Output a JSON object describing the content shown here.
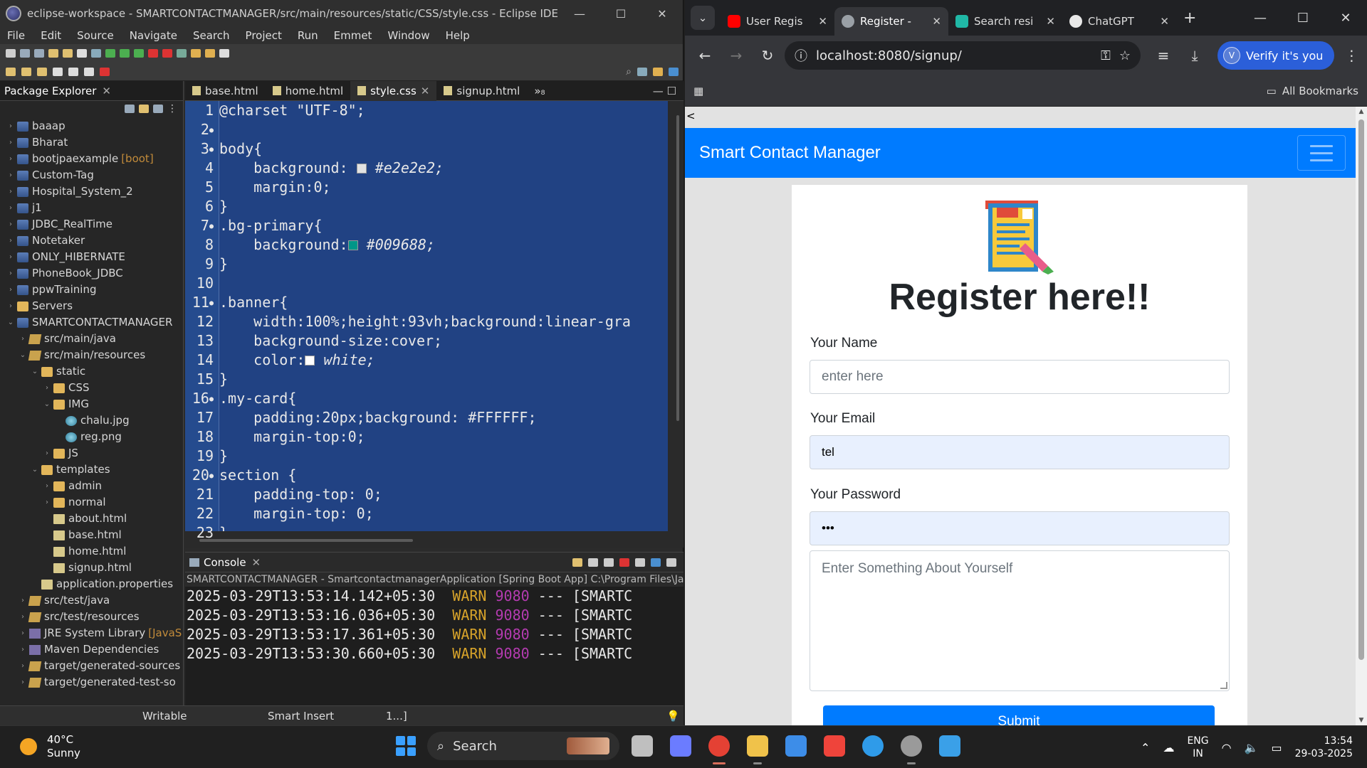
{
  "eclipse": {
    "title": "eclipse-workspace - SMARTCONTACTMANAGER/src/main/resources/static/CSS/style.css - Eclipse IDE",
    "menu": [
      "File",
      "Edit",
      "Source",
      "Navigate",
      "Search",
      "Project",
      "Run",
      "Emmet",
      "Window",
      "Help"
    ],
    "package_explorer": {
      "label": "Package Explorer",
      "items": [
        {
          "label": "baaap",
          "indent": 0,
          "icon": "project-icon"
        },
        {
          "label": "Bharat",
          "indent": 0,
          "icon": "project-icon"
        },
        {
          "label": "bootjpaexample",
          "decoration": "[boot]",
          "indent": 0,
          "icon": "project-icon"
        },
        {
          "label": "Custom-Tag",
          "indent": 0,
          "icon": "project-icon"
        },
        {
          "label": "Hospital_System_2",
          "indent": 0,
          "icon": "project-icon"
        },
        {
          "label": "j1",
          "indent": 0,
          "icon": "project-icon"
        },
        {
          "label": "JDBC_RealTime",
          "indent": 0,
          "icon": "project-icon"
        },
        {
          "label": "Notetaker",
          "indent": 0,
          "icon": "project-icon"
        },
        {
          "label": "ONLY_HIBERNATE",
          "indent": 0,
          "icon": "project-icon"
        },
        {
          "label": "PhoneBook_JDBC",
          "indent": 0,
          "icon": "project-icon"
        },
        {
          "label": "ppwTraining",
          "indent": 0,
          "icon": "project-icon"
        },
        {
          "label": "Servers",
          "indent": 0,
          "icon": "folder-icon"
        },
        {
          "label": "SMARTCONTACTMANAGER",
          "indent": 0,
          "icon": "project-icon"
        },
        {
          "label": "src/main/java",
          "indent": 1,
          "icon": "package-folder-icon"
        },
        {
          "label": "src/main/resources",
          "indent": 1,
          "icon": "package-folder-icon"
        },
        {
          "label": "static",
          "indent": 2,
          "icon": "folder-icon"
        },
        {
          "label": "CSS",
          "indent": 3,
          "icon": "folder-icon"
        },
        {
          "label": "IMG",
          "indent": 3,
          "icon": "folder-icon"
        },
        {
          "label": "chalu.jpg",
          "indent": 4,
          "icon": "image-file-icon"
        },
        {
          "label": "reg.png",
          "indent": 4,
          "icon": "image-file-icon"
        },
        {
          "label": "JS",
          "indent": 3,
          "icon": "folder-icon"
        },
        {
          "label": "templates",
          "indent": 2,
          "icon": "folder-icon"
        },
        {
          "label": "admin",
          "indent": 3,
          "icon": "folder-icon"
        },
        {
          "label": "normal",
          "indent": 3,
          "icon": "folder-icon"
        },
        {
          "label": "about.html",
          "indent": 3,
          "icon": "html-file-icon"
        },
        {
          "label": "base.html",
          "indent": 3,
          "icon": "html-file-icon"
        },
        {
          "label": "home.html",
          "indent": 3,
          "icon": "html-file-icon"
        },
        {
          "label": "signup.html",
          "indent": 3,
          "icon": "html-file-icon"
        },
        {
          "label": "application.properties",
          "indent": 2,
          "icon": "properties-file-icon"
        },
        {
          "label": "src/test/java",
          "indent": 1,
          "icon": "package-folder-icon"
        },
        {
          "label": "src/test/resources",
          "indent": 1,
          "icon": "package-folder-icon"
        },
        {
          "label": "JRE System Library",
          "decoration": "[JavaS",
          "indent": 1,
          "icon": "library-icon"
        },
        {
          "label": "Maven Dependencies",
          "indent": 1,
          "icon": "library-icon"
        },
        {
          "label": "target/generated-sources",
          "indent": 1,
          "icon": "package-folder-icon"
        },
        {
          "label": "target/generated-test-so",
          "indent": 1,
          "icon": "package-folder-icon"
        }
      ]
    },
    "editor_tabs": [
      {
        "label": "base.html",
        "active": false
      },
      {
        "label": "home.html",
        "active": false
      },
      {
        "label": "style.css",
        "active": true
      },
      {
        "label": "signup.html",
        "active": false
      }
    ],
    "editor_overflow": "»₈",
    "code_lines": [
      {
        "n": "1",
        "dot": "",
        "text": "@charset \"UTF-8\";"
      },
      {
        "n": "2",
        "dot": "●",
        "text": ""
      },
      {
        "n": "3",
        "dot": "●",
        "text": "body{"
      },
      {
        "n": "4",
        "dot": "",
        "text": "    background: ",
        "swatch": "#e2e2e2",
        "after": " #e2e2e2;"
      },
      {
        "n": "5",
        "dot": "",
        "text": "    margin:0;"
      },
      {
        "n": "6",
        "dot": "",
        "text": "}"
      },
      {
        "n": "7",
        "dot": "●",
        "text": ".bg-primary{"
      },
      {
        "n": "8",
        "dot": "",
        "text": "    background:",
        "swatch": "#009688",
        "after": " #009688;"
      },
      {
        "n": "9",
        "dot": "",
        "text": "}"
      },
      {
        "n": "10",
        "dot": "",
        "text": ""
      },
      {
        "n": "11",
        "dot": "●",
        "text": ".banner{"
      },
      {
        "n": "12",
        "dot": "",
        "text": "    width:100%;height:93vh;background:linear-gra"
      },
      {
        "n": "13",
        "dot": "",
        "text": "    background-size:cover;"
      },
      {
        "n": "14",
        "dot": "",
        "text": "    color:",
        "swatch": "#ffffff",
        "after": " white;"
      },
      {
        "n": "15",
        "dot": "",
        "text": "}"
      },
      {
        "n": "16",
        "dot": "●",
        "text": ".my-card{"
      },
      {
        "n": "17",
        "dot": "",
        "text": "    padding:20px;background: #FFFFFF;"
      },
      {
        "n": "18",
        "dot": "",
        "text": "    margin-top:0;"
      },
      {
        "n": "19",
        "dot": "",
        "text": "}"
      },
      {
        "n": "20",
        "dot": "●",
        "text": "section {"
      },
      {
        "n": "21",
        "dot": "",
        "text": "    padding-top: 0;"
      },
      {
        "n": "22",
        "dot": "",
        "text": "    margin-top: 0;"
      },
      {
        "n": "23",
        "dot": "",
        "text": "}"
      }
    ],
    "console": {
      "label": "Console",
      "subtitle": "SMARTCONTACTMANAGER - SmartcontactmanagerApplication [Spring Boot App] C:\\Program Files\\Java\\",
      "logs": [
        {
          "ts": "2025-03-29T13:53:14.142+05:30",
          "level": "WARN",
          "pid": "9080",
          "rest": "--- [SMARTC"
        },
        {
          "ts": "2025-03-29T13:53:16.036+05:30",
          "level": "WARN",
          "pid": "9080",
          "rest": "--- [SMARTC"
        },
        {
          "ts": "2025-03-29T13:53:17.361+05:30",
          "level": "WARN",
          "pid": "9080",
          "rest": "--- [SMARTC"
        },
        {
          "ts": "2025-03-29T13:53:30.660+05:30",
          "level": "WARN",
          "pid": "9080",
          "rest": "--- [SMARTC"
        }
      ]
    },
    "status": {
      "writable": "Writable",
      "insert_mode": "Smart Insert",
      "position": "1...]"
    }
  },
  "browser": {
    "tabs": [
      {
        "label": "User Regis",
        "active": false,
        "favicon": "youtube-icon",
        "color": "#ff0000"
      },
      {
        "label": "Register - ",
        "active": true,
        "favicon": "globe-icon",
        "color": "#9aa0a6"
      },
      {
        "label": "Search resi",
        "active": false,
        "favicon": "perplexity-icon",
        "color": "#20b8a6"
      },
      {
        "label": "ChatGPT",
        "active": false,
        "favicon": "chatgpt-icon",
        "color": "#e8e8e8"
      }
    ],
    "url": "localhost:8080/signup/",
    "verify_label": "Verify it's you",
    "bookmarks_label": "All Bookmarks"
  },
  "page": {
    "back_link": "<",
    "brand": "Smart Contact Manager",
    "title": "Register here!!",
    "name_label": "Your Name",
    "name_placeholder": "enter here",
    "email_label": "Your Email",
    "email_value": "tel",
    "password_label": "Your Password",
    "password_value": "•••",
    "about_placeholder": "Enter Something About Yourself",
    "submit_label": "Submit",
    "colors": {
      "navbar": "#007bff",
      "page_bg": "#e2e2e2",
      "autofill": "#e8f0fe"
    }
  },
  "taskbar": {
    "temperature": "40°C",
    "condition": "Sunny",
    "search_label": "Search",
    "lang": "ENG",
    "region": "IN",
    "time": "13:54",
    "date": "29-03-2025",
    "apps": [
      {
        "name": "task-view-icon",
        "color": "#bfbfbf"
      },
      {
        "name": "copilot-icon",
        "color": "#6b7cff"
      },
      {
        "name": "chrome-icon",
        "color": "#e44134",
        "active": true
      },
      {
        "name": "file-explorer-icon",
        "color": "#f0c24a"
      },
      {
        "name": "microsoft-store-icon",
        "color": "#3d8de8"
      },
      {
        "name": "anydesk-icon",
        "color": "#ef443b"
      },
      {
        "name": "get-help-icon",
        "color": "#2f9be9"
      },
      {
        "name": "settings-icon",
        "color": "#9a9a9a"
      },
      {
        "name": "photos-icon",
        "color": "#3aa0e8"
      }
    ]
  }
}
